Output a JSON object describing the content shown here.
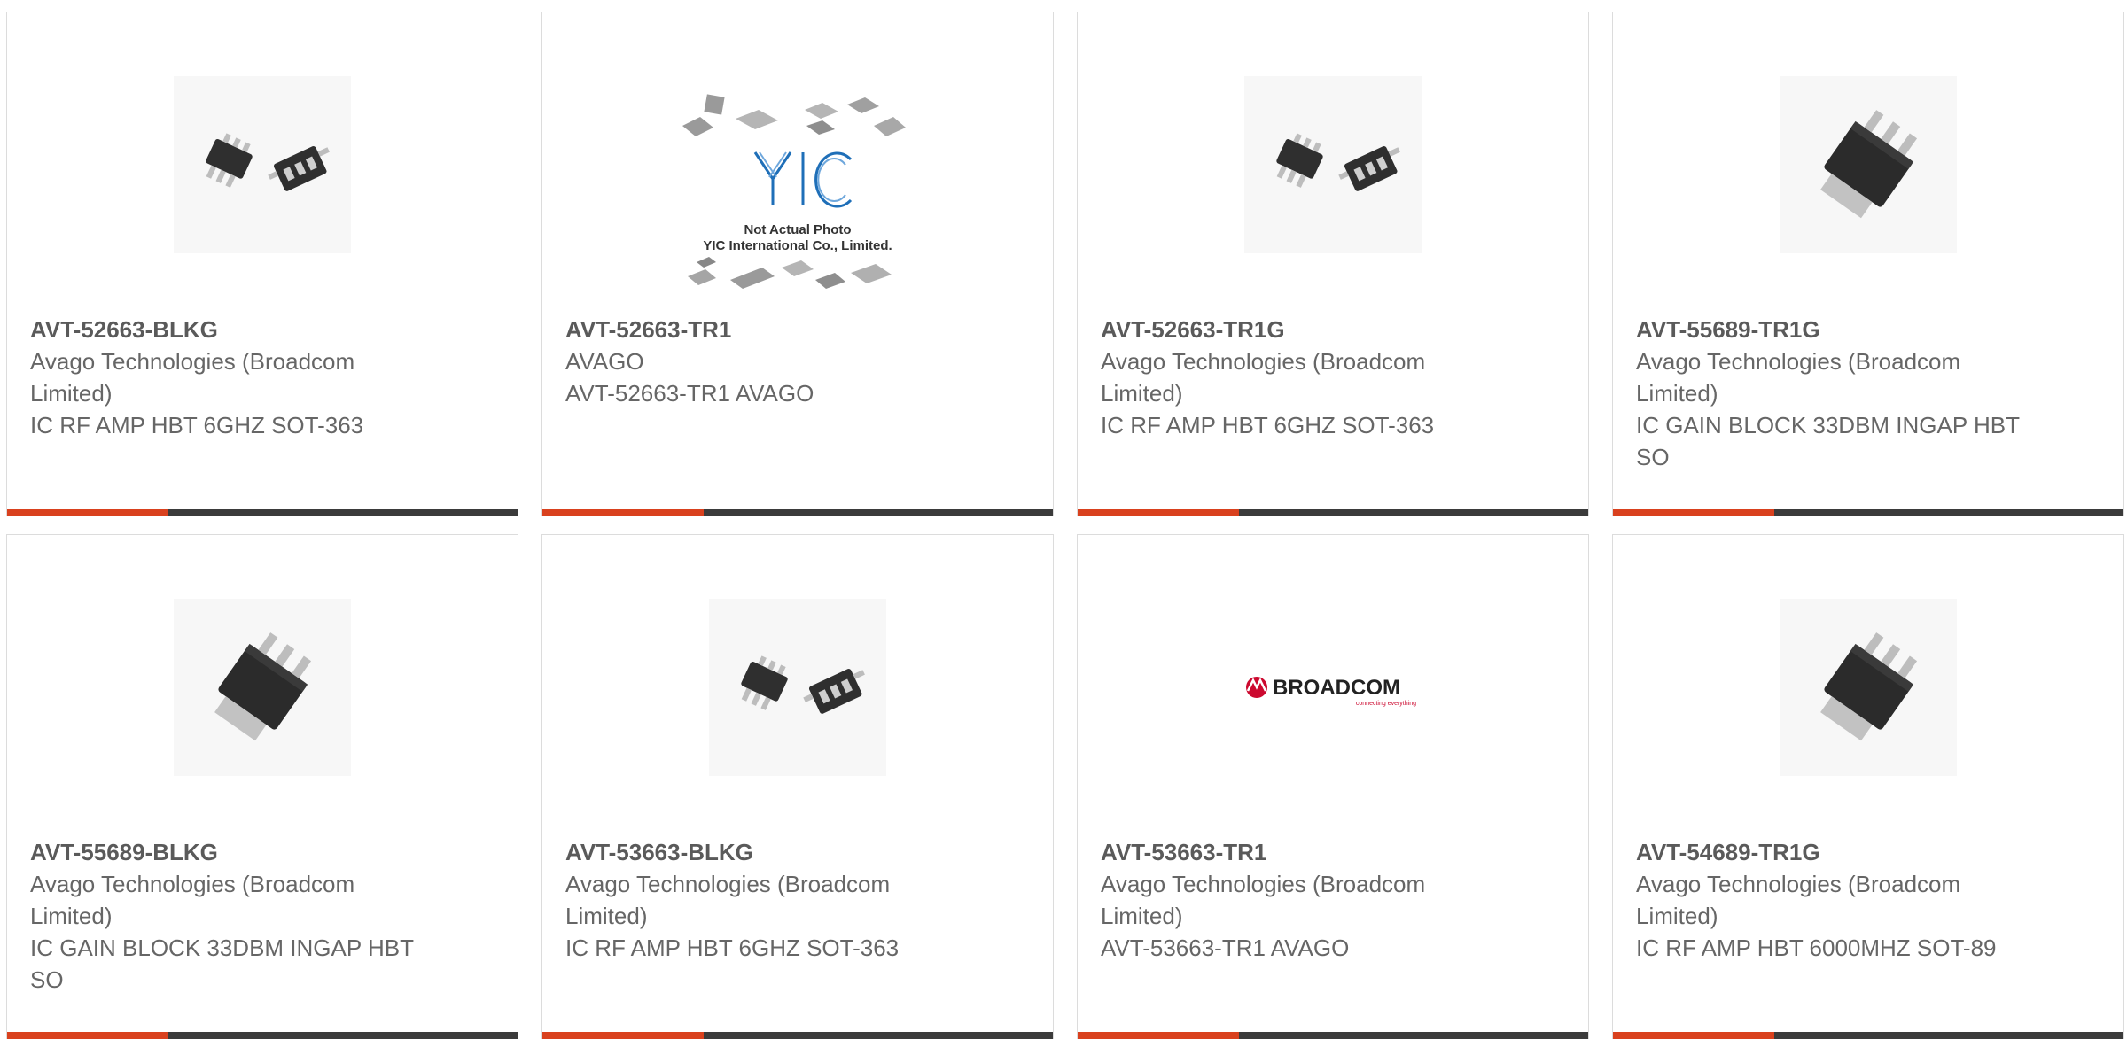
{
  "products": [
    {
      "part": "AVT-52663-BLKG",
      "manufacturer": "Avago Technologies (Broadcom Limited)",
      "description": "IC RF AMP HBT 6GHZ SOT-363",
      "image": "sot363-chip-image"
    },
    {
      "part": "AVT-52663-TR1",
      "manufacturer": "AVAGO",
      "description": "AVT-52663-TR1 AVAGO",
      "image": "yic-placeholder-image",
      "placeholder_line1": "Not Actual Photo",
      "placeholder_line2": "YIC International Co., Limited.",
      "placeholder_logo": "YIC"
    },
    {
      "part": "AVT-52663-TR1G",
      "manufacturer": "Avago Technologies (Broadcom Limited)",
      "description": "IC RF AMP HBT 6GHZ SOT-363",
      "image": "sot363-chip-image"
    },
    {
      "part": "AVT-55689-TR1G",
      "manufacturer": "Avago Technologies (Broadcom Limited)",
      "description": "IC GAIN BLOCK 33DBM INGAP HBT SO",
      "image": "sot89-chip-image"
    },
    {
      "part": "AVT-55689-BLKG",
      "manufacturer": "Avago Technologies (Broadcom Limited)",
      "description": "IC GAIN BLOCK 33DBM INGAP HBT SO",
      "image": "sot89-chip-image"
    },
    {
      "part": "AVT-53663-BLKG",
      "manufacturer": "Avago Technologies (Broadcom Limited)",
      "description": "IC RF AMP HBT 6GHZ SOT-363",
      "image": "sot363-chip-image"
    },
    {
      "part": "AVT-53663-TR1",
      "manufacturer": "Avago Technologies (Broadcom Limited)",
      "description": "AVT-53663-TR1 AVAGO",
      "image": "broadcom-logo",
      "logo_text": "BROADCOM",
      "logo_tagline": "connecting everything"
    },
    {
      "part": "AVT-54689-TR1G",
      "manufacturer": "Avago Technologies (Broadcom Limited)",
      "description": "IC RF AMP HBT 6000MHZ SOT-89",
      "image": "sot89-chip-image"
    }
  ],
  "colors": {
    "accent": "#d9411e",
    "bar": "#3b3b3b",
    "border": "#dcdcdc"
  }
}
